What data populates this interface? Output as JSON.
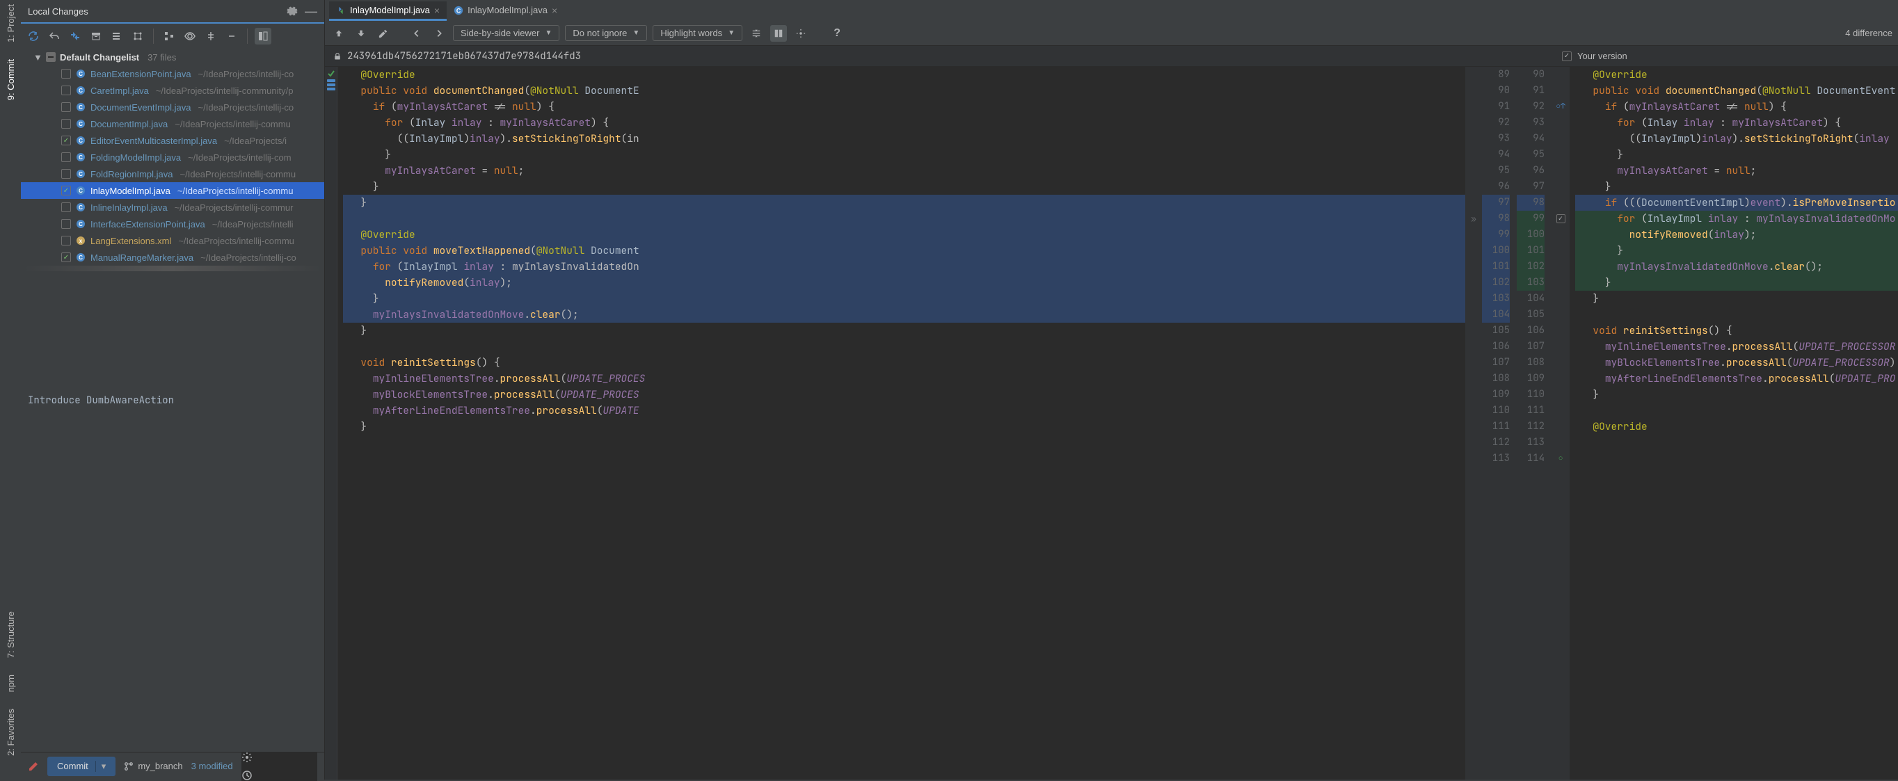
{
  "strip": {
    "project": "1: Project",
    "commit": "9: Commit",
    "structure": "7: Structure",
    "npm": "npm",
    "favorites": "2: Favorites"
  },
  "panel": {
    "title": "Local Changes",
    "changelist": "Default Changelist",
    "count": "37 files",
    "files": [
      {
        "name": "BeanExtensionPoint.java",
        "path": "~/IdeaProjects/intellij-co",
        "chk": false,
        "kind": "java"
      },
      {
        "name": "CaretImpl.java",
        "path": "~/IdeaProjects/intellij-community/p",
        "chk": false,
        "kind": "java"
      },
      {
        "name": "DocumentEventImpl.java",
        "path": "~/IdeaProjects/intellij-co",
        "chk": false,
        "kind": "java"
      },
      {
        "name": "DocumentImpl.java",
        "path": "~/IdeaProjects/intellij-commu",
        "chk": false,
        "kind": "java"
      },
      {
        "name": "EditorEventMulticasterImpl.java",
        "path": "~/IdeaProjects/i",
        "chk": true,
        "kind": "java"
      },
      {
        "name": "FoldingModelImpl.java",
        "path": "~/IdeaProjects/intellij-com",
        "chk": false,
        "kind": "java"
      },
      {
        "name": "FoldRegionImpl.java",
        "path": "~/IdeaProjects/intellij-commu",
        "chk": false,
        "kind": "java"
      },
      {
        "name": "InlayModelImpl.java",
        "path": "~/IdeaProjects/intellij-commu",
        "chk": true,
        "kind": "java",
        "selected": true
      },
      {
        "name": "InlineInlayImpl.java",
        "path": "~/IdeaProjects/intellij-commur",
        "chk": false,
        "kind": "java"
      },
      {
        "name": "InterfaceExtensionPoint.java",
        "path": "~/IdeaProjects/intelli",
        "chk": false,
        "kind": "java"
      },
      {
        "name": "LangExtensions.xml",
        "path": "~/IdeaProjects/intellij-commu",
        "chk": false,
        "kind": "xml"
      },
      {
        "name": "ManualRangeMarker.java",
        "path": "~/IdeaProjects/intellij-co",
        "chk": true,
        "kind": "java"
      }
    ],
    "commit_message": "Introduce DumbAwareAction",
    "commit_label": "Commit",
    "branch": "my_branch",
    "modified": "3 modified"
  },
  "tabs": [
    {
      "name": "InlayModelImpl.java",
      "active": true,
      "icon": "diff"
    },
    {
      "name": "InlayModelImpl.java",
      "active": false,
      "icon": "class"
    }
  ],
  "diffbar": {
    "viewer": "Side-by-side viewer",
    "ignore": "Do not ignore",
    "highlight": "Highlight words",
    "count": "4 difference"
  },
  "revision": {
    "left_hash": "243961db4756272171eb067437d7e9784d144fd3",
    "right_label": "Your version"
  },
  "left_code": [
    {
      "n": "",
      "cls": "",
      "txt": "  @Override"
    },
    {
      "n": "",
      "cls": "",
      "txt": "  public void documentChanged(@NotNull DocumentE"
    },
    {
      "n": "",
      "cls": "",
      "txt": "    if (myInlaysAtCaret != null) {"
    },
    {
      "n": "",
      "cls": "",
      "txt": "      for (Inlay inlay : myInlaysAtCaret) {"
    },
    {
      "n": "",
      "cls": "",
      "txt": "        ((InlayImpl)inlay).setStickingToRight(in"
    },
    {
      "n": "",
      "cls": "",
      "txt": "      }"
    },
    {
      "n": "",
      "cls": "",
      "txt": "      myInlaysAtCaret = null;"
    },
    {
      "n": "",
      "cls": "",
      "txt": "    }"
    },
    {
      "n": "",
      "cls": "modified",
      "txt": "  }"
    },
    {
      "n": "",
      "cls": "modified",
      "txt": ""
    },
    {
      "n": "",
      "cls": "modified",
      "txt": "  @Override"
    },
    {
      "n": "",
      "cls": "modified",
      "txt": "  public void moveTextHappened(@NotNull Document"
    },
    {
      "n": "",
      "cls": "modified",
      "txt": "    for (InlayImpl inlay : myInlaysInvalidatedOn"
    },
    {
      "n": "",
      "cls": "modified",
      "txt": "      notifyRemoved(inlay);"
    },
    {
      "n": "",
      "cls": "modified",
      "txt": "    }"
    },
    {
      "n": "",
      "cls": "modified",
      "txt": "    myInlaysInvalidatedOnMove.clear();"
    },
    {
      "n": "",
      "cls": "",
      "txt": "  }"
    },
    {
      "n": "",
      "cls": "",
      "txt": ""
    },
    {
      "n": "",
      "cls": "",
      "txt": "  void reinitSettings() {"
    },
    {
      "n": "",
      "cls": "",
      "txt": "    myInlineElementsTree.processAll(UPDATE_PROCES"
    },
    {
      "n": "",
      "cls": "",
      "txt": "    myBlockElementsTree.processAll(UPDATE_PROCES"
    },
    {
      "n": "",
      "cls": "",
      "txt": "    myAfterLineEndElementsTree.processAll(UPDATE"
    },
    {
      "n": "",
      "cls": "",
      "txt": "  }"
    },
    {
      "n": "",
      "cls": "",
      "txt": ""
    }
  ],
  "nums_left": [
    "89",
    "90",
    "91",
    "92",
    "93",
    "94",
    "95",
    "96",
    "97",
    "98",
    "99",
    "100",
    "101",
    "102",
    "103",
    "104",
    "105",
    "106",
    "107",
    "108",
    "109",
    "110",
    "111",
    "112",
    "113"
  ],
  "nums_right": [
    "90",
    "91",
    "92",
    "93",
    "94",
    "95",
    "96",
    "97",
    "98",
    "99",
    "100",
    "101",
    "102",
    "103",
    "104",
    "105",
    "106",
    "107",
    "108",
    "109",
    "110",
    "111",
    "112",
    "113",
    "114"
  ],
  "right_code": [
    {
      "cls": "",
      "txt": "  @Override"
    },
    {
      "cls": "",
      "txt": "  public void documentChanged(@NotNull DocumentEvent"
    },
    {
      "cls": "",
      "txt": "    if (myInlaysAtCaret != null) {"
    },
    {
      "cls": "",
      "txt": "      for (Inlay inlay : myInlaysAtCaret) {"
    },
    {
      "cls": "",
      "txt": "        ((InlayImpl)inlay).setStickingToRight(inlay"
    },
    {
      "cls": "",
      "txt": "      }"
    },
    {
      "cls": "",
      "txt": "      myInlaysAtCaret = null;"
    },
    {
      "cls": "",
      "txt": "    }"
    },
    {
      "cls": "modified",
      "txt": "    if (((DocumentEventImpl)event).isPreMoveInsertio"
    },
    {
      "cls": "added",
      "txt": "      for (InlayImpl inlay : myInlaysInvalidatedOnMo"
    },
    {
      "cls": "added",
      "txt": "        notifyRemoved(inlay);"
    },
    {
      "cls": "added",
      "txt": "      }"
    },
    {
      "cls": "added",
      "txt": "      myInlaysInvalidatedOnMove.clear();"
    },
    {
      "cls": "added",
      "txt": "    }"
    },
    {
      "cls": "",
      "txt": "  }"
    },
    {
      "cls": "",
      "txt": ""
    },
    {
      "cls": "",
      "txt": "  void reinitSettings() {"
    },
    {
      "cls": "",
      "txt": "    myInlineElementsTree.processAll(UPDATE_PROCESSOR"
    },
    {
      "cls": "",
      "txt": "    myBlockElementsTree.processAll(UPDATE_PROCESSOR)"
    },
    {
      "cls": "",
      "txt": "    myAfterLineEndElementsTree.processAll(UPDATE_PRO"
    },
    {
      "cls": "",
      "txt": "  }"
    },
    {
      "cls": "",
      "txt": ""
    },
    {
      "cls": "",
      "txt": "  @Override"
    },
    {
      "cls": "",
      "txt": ""
    }
  ]
}
